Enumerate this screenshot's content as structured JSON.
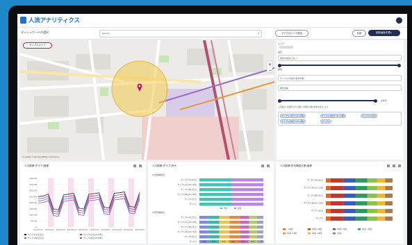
{
  "app": {
    "logo_text": "人流アナリティクス"
  },
  "toolbar": {
    "title": "ダッシュボードの選択",
    "select_value": "sample",
    "btn_label": "マイクロエリア設定",
    "btn_save": "名前",
    "btn_primary": "削除画面を開く"
  },
  "map": {
    "chip_label": "サンプルエリア",
    "attribution": "© Leaflet © OpenStreetMap contributors"
  },
  "panel": {
    "l1": "エリア",
    "l2": "設定",
    "select1": "過去を指定しない",
    "l3": "期間",
    "select2": "サンプル(下記の全件対象)",
    "select3": "属性全般",
    "end_label": "全年代",
    "note": "この集計には選択された期間・時間帯の推計結果を表示します",
    "chips": [
      "サンプル(平日 10-12時)",
      "サンプル(休日 10-12時)",
      "サンプル(平日)",
      "サンプル(休日 10-12時)",
      "サンプル"
    ]
  },
  "cards": {
    "c1_title": "人口推移(グラフ)推移",
    "c2_title": "人口推移(グラフ)年代",
    "c3_title": "人口推移(年代構成比率)推移",
    "c2_sub1": "1)性別構成比",
    "c2_sub2": "2)年代構成比"
  },
  "chart1": {
    "type": "line",
    "ylabels": [
      "400,000",
      "350,000",
      "300,000",
      "250,000",
      "200,000",
      "150,000",
      "100,000",
      "50,000",
      "0"
    ],
    "xlabels": [
      "2023/01/01",
      "2023/01/15",
      "2023/02/01",
      "2023/02/15",
      "2023/03/01",
      "2023/03/15",
      "2023/04/01",
      "2023/04/15",
      "2023/05/01",
      "2023/05/15"
    ],
    "legend": [
      "サンプル(平日全日)",
      "サンプル(平日10-12時)",
      "サンプル(休日全日)",
      "サンプル(休日10-12時)"
    ],
    "colors": [
      "#1c2332",
      "#c8326a",
      "#4a78c2",
      "#9a4fb5"
    ]
  },
  "chart2": {
    "type": "bar",
    "rows1": [
      "サンプル(平日全日)",
      "サンプル(平日10-12時)",
      "サンプル(休日全日)",
      "サンプル(休日10-12時)",
      "サンプル(全日)",
      "サンプル"
    ],
    "rows2": [
      "サンプル(平日全日)",
      "サンプル(平日10-12時)",
      "サンプル(休日全日)",
      "サンプル(休日10-12時)",
      "サンプル(全日)",
      "サンプル"
    ],
    "legend1": [
      "男性",
      "女性"
    ],
    "legend2": [
      "10代",
      "20代",
      "30代",
      "40代",
      "50代",
      "60代",
      "70代"
    ],
    "colors1": [
      "#43c3b4",
      "#b987e0"
    ],
    "colors2": [
      "#7c8fd6",
      "#45b3a6",
      "#e6c65a",
      "#de8b4a",
      "#c36bb6",
      "#b3c86d",
      "#9ea6b4"
    ]
  },
  "chart3": {
    "type": "bar",
    "rows": [
      "サンプル(平日全日)",
      "サンプル(平日10-12時)",
      "サンプル(休日全日)",
      "サンプル(休日10-12時)",
      "サンプル(全日)",
      "サンプル"
    ],
    "legend": [
      "~19歳",
      "20歳~29歳",
      "30歳~39歳",
      "40歳~49歳",
      "50歳~59歳",
      "60歳~69歳",
      "70歳~"
    ],
    "colors": [
      "#e8661e",
      "#c0392b",
      "#3b5cb8",
      "#2e9a61",
      "#8bc34a",
      "#f2b632",
      "#a37c52"
    ]
  }
}
